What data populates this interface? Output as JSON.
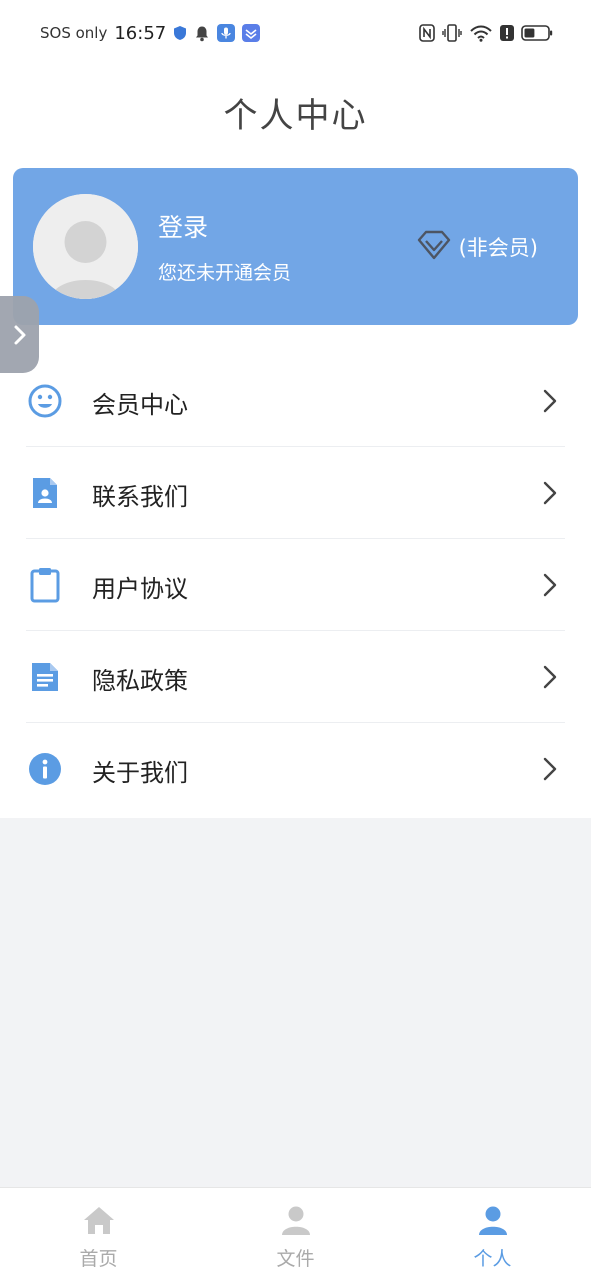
{
  "status_bar": {
    "carrier": "SOS only",
    "time": "16:57",
    "battery_level": 0.45
  },
  "header": {
    "title": "个人中心"
  },
  "profile": {
    "login_label": "登录",
    "member_status": "您还未开通会员",
    "vip_label": "(非会员)"
  },
  "menu": {
    "items": [
      {
        "label": "会员中心",
        "icon": "smile-icon"
      },
      {
        "label": "联系我们",
        "icon": "contact-card-icon"
      },
      {
        "label": "用户协议",
        "icon": "clipboard-icon"
      },
      {
        "label": "隐私政策",
        "icon": "document-icon"
      },
      {
        "label": "关于我们",
        "icon": "info-icon"
      }
    ]
  },
  "tab_bar": {
    "tabs": [
      {
        "label": "首页",
        "icon": "home-icon",
        "active": false
      },
      {
        "label": "文件",
        "icon": "person-icon",
        "active": false
      },
      {
        "label": "个人",
        "icon": "person-icon",
        "active": true
      }
    ]
  },
  "colors": {
    "accent": "#72a6e6",
    "icon_blue": "#5b9ce3",
    "inactive": "#aaaaaa",
    "background": "#f2f3f5"
  }
}
